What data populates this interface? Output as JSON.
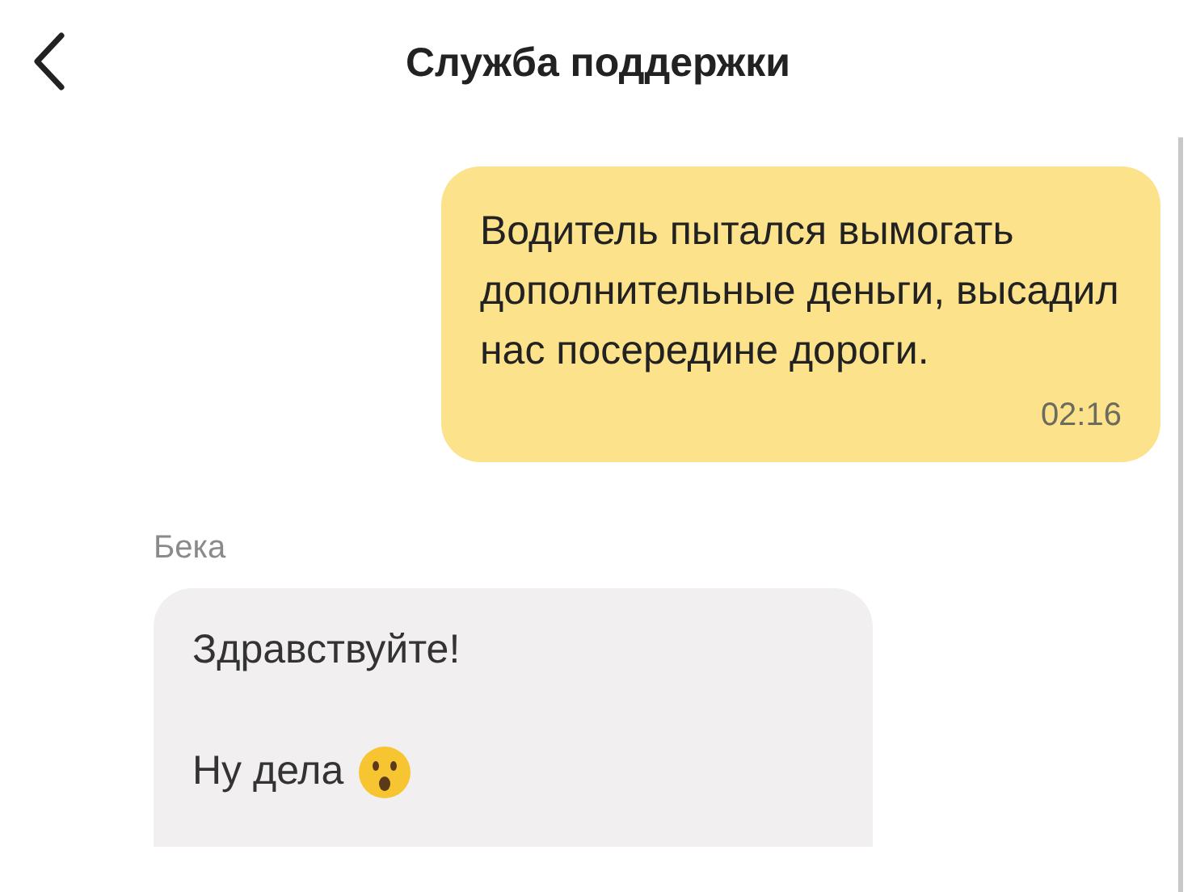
{
  "header": {
    "title": "Служба поддержки"
  },
  "messages": [
    {
      "kind": "outgoing",
      "text": "Водитель пытался вымогать дополнительные деньги, высадил нас посередине дороги.",
      "time": "02:16"
    },
    {
      "kind": "incoming",
      "sender": "Бека",
      "paragraphs": [
        "Здравствуйте!",
        "Ну дела"
      ]
    }
  ]
}
